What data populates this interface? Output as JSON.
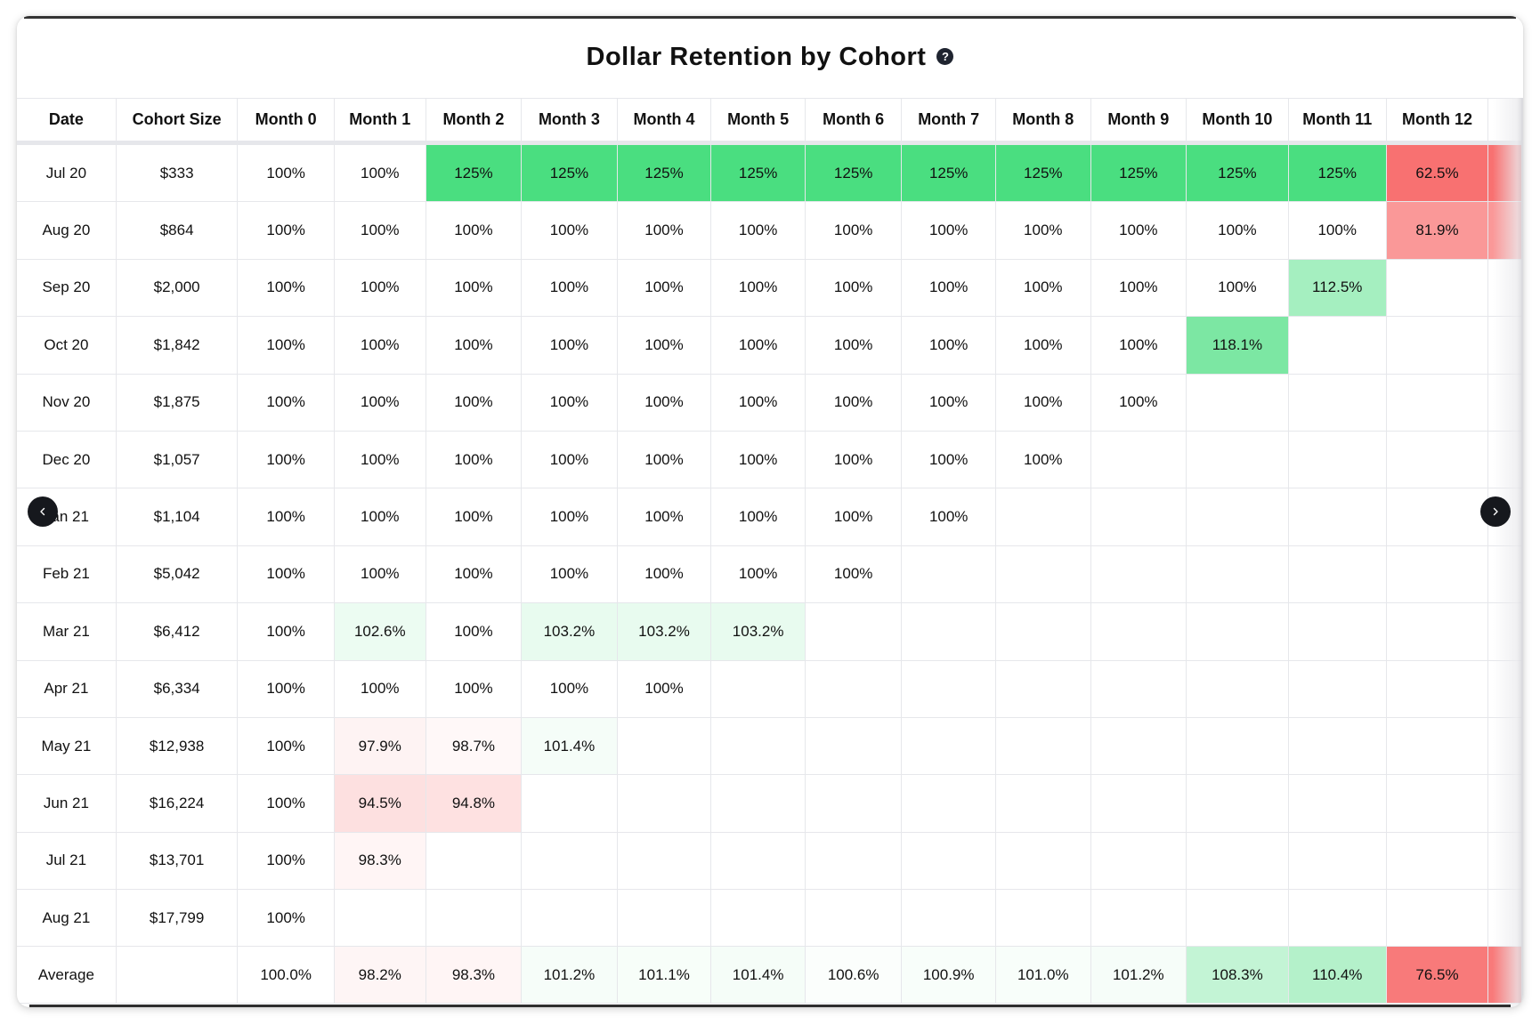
{
  "title": "Dollar Retention by Cohort",
  "help_icon": "question-circle-icon",
  "nav": {
    "prev_icon": "chevron-left-icon",
    "next_icon": "chevron-right-icon"
  },
  "colors": {
    "positive": "#4ADE80",
    "negative": "#F87171",
    "neutral": "#FFFFFF",
    "grid": "#E6E7EB",
    "title_text": "#111111"
  },
  "table": {
    "columns": [
      "Date",
      "Cohort Size",
      "Month 0",
      "Month 1",
      "Month 2",
      "Month 3",
      "Month 4",
      "Month 5",
      "Month 6",
      "Month 7",
      "Month 8",
      "Month 9",
      "Month 10",
      "Month 11",
      "Month 12",
      ""
    ],
    "rows": [
      {
        "date": "Jul 20",
        "size": "$333",
        "cells": [
          "100%",
          "100%",
          "125%",
          "125%",
          "125%",
          "125%",
          "125%",
          "125%",
          "125%",
          "125%",
          "125%",
          "125%",
          "62.5%",
          ""
        ]
      },
      {
        "date": "Aug 20",
        "size": "$864",
        "cells": [
          "100%",
          "100%",
          "100%",
          "100%",
          "100%",
          "100%",
          "100%",
          "100%",
          "100%",
          "100%",
          "100%",
          "100%",
          "81.9%",
          ""
        ]
      },
      {
        "date": "Sep 20",
        "size": "$2,000",
        "cells": [
          "100%",
          "100%",
          "100%",
          "100%",
          "100%",
          "100%",
          "100%",
          "100%",
          "100%",
          "100%",
          "100%",
          "112.5%",
          "",
          ""
        ]
      },
      {
        "date": "Oct 20",
        "size": "$1,842",
        "cells": [
          "100%",
          "100%",
          "100%",
          "100%",
          "100%",
          "100%",
          "100%",
          "100%",
          "100%",
          "100%",
          "118.1%",
          "",
          "",
          ""
        ]
      },
      {
        "date": "Nov 20",
        "size": "$1,875",
        "cells": [
          "100%",
          "100%",
          "100%",
          "100%",
          "100%",
          "100%",
          "100%",
          "100%",
          "100%",
          "100%",
          "",
          "",
          "",
          ""
        ]
      },
      {
        "date": "Dec 20",
        "size": "$1,057",
        "cells": [
          "100%",
          "100%",
          "100%",
          "100%",
          "100%",
          "100%",
          "100%",
          "100%",
          "100%",
          "",
          "",
          "",
          "",
          ""
        ]
      },
      {
        "date": "Jan 21",
        "size": "$1,104",
        "cells": [
          "100%",
          "100%",
          "100%",
          "100%",
          "100%",
          "100%",
          "100%",
          "100%",
          "",
          "",
          "",
          "",
          "",
          ""
        ]
      },
      {
        "date": "Feb 21",
        "size": "$5,042",
        "cells": [
          "100%",
          "100%",
          "100%",
          "100%",
          "100%",
          "100%",
          "100%",
          "",
          "",
          "",
          "",
          "",
          "",
          ""
        ]
      },
      {
        "date": "Mar 21",
        "size": "$6,412",
        "cells": [
          "100%",
          "102.6%",
          "100%",
          "103.2%",
          "103.2%",
          "103.2%",
          "",
          "",
          "",
          "",
          "",
          "",
          "",
          ""
        ]
      },
      {
        "date": "Apr 21",
        "size": "$6,334",
        "cells": [
          "100%",
          "100%",
          "100%",
          "100%",
          "100%",
          "",
          "",
          "",
          "",
          "",
          "",
          "",
          "",
          ""
        ]
      },
      {
        "date": "May 21",
        "size": "$12,938",
        "cells": [
          "100%",
          "97.9%",
          "98.7%",
          "101.4%",
          "",
          "",
          "",
          "",
          "",
          "",
          "",
          "",
          "",
          ""
        ]
      },
      {
        "date": "Jun 21",
        "size": "$16,224",
        "cells": [
          "100%",
          "94.5%",
          "94.8%",
          "",
          "",
          "",
          "",
          "",
          "",
          "",
          "",
          "",
          "",
          ""
        ]
      },
      {
        "date": "Jul 21",
        "size": "$13,701",
        "cells": [
          "100%",
          "98.3%",
          "",
          "",
          "",
          "",
          "",
          "",
          "",
          "",
          "",
          "",
          "",
          ""
        ]
      },
      {
        "date": "Aug 21",
        "size": "$17,799",
        "cells": [
          "100%",
          "",
          "",
          "",
          "",
          "",
          "",
          "",
          "",
          "",
          "",
          "",
          "",
          ""
        ]
      }
    ],
    "average": {
      "label": "Average",
      "size": "",
      "cells": [
        "100.0%",
        "98.2%",
        "98.3%",
        "101.2%",
        "101.1%",
        "101.4%",
        "100.6%",
        "100.9%",
        "101.0%",
        "101.2%",
        "108.3%",
        "110.4%",
        "76.5%",
        ""
      ]
    },
    "clipped_column_fill": [
      "62.5%",
      "81.9%",
      "",
      "",
      "",
      "",
      "",
      "",
      "",
      "",
      "",
      "",
      "",
      "",
      "76.5%"
    ]
  }
}
